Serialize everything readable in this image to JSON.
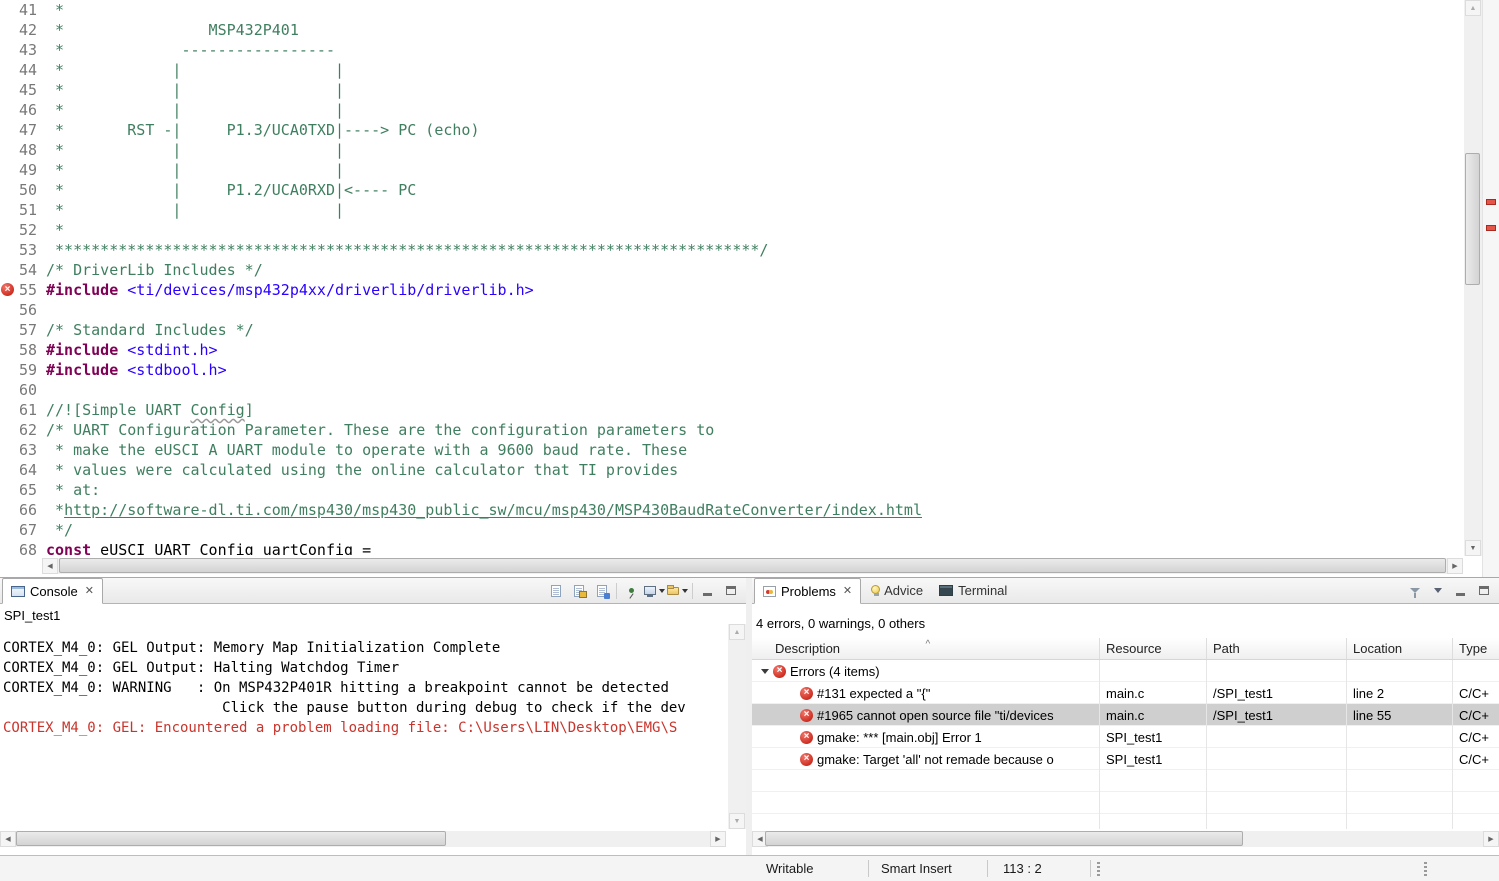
{
  "editor": {
    "lines": [
      {
        "n": "41",
        "segs": [
          {
            "t": " *",
            "c": "cm"
          }
        ]
      },
      {
        "n": "42",
        "segs": [
          {
            "t": " *                MSP432P401",
            "c": "cm"
          }
        ]
      },
      {
        "n": "43",
        "segs": [
          {
            "t": " *             -----------------",
            "c": "cm"
          }
        ]
      },
      {
        "n": "44",
        "segs": [
          {
            "t": " *            |                 |",
            "c": "cm"
          }
        ]
      },
      {
        "n": "45",
        "segs": [
          {
            "t": " *            |                 |",
            "c": "cm"
          }
        ]
      },
      {
        "n": "46",
        "segs": [
          {
            "t": " *            |                 |",
            "c": "cm"
          }
        ]
      },
      {
        "n": "47",
        "segs": [
          {
            "t": " *       RST -|     P1.3/UCA0TXD|----> PC (echo)",
            "c": "cm"
          }
        ]
      },
      {
        "n": "48",
        "segs": [
          {
            "t": " *            |                 |",
            "c": "cm"
          }
        ]
      },
      {
        "n": "49",
        "segs": [
          {
            "t": " *            |                 |",
            "c": "cm"
          }
        ]
      },
      {
        "n": "50",
        "segs": [
          {
            "t": " *            |     P1.2/UCA0RXD|<---- PC",
            "c": "cm"
          }
        ]
      },
      {
        "n": "51",
        "segs": [
          {
            "t": " *            |                 |",
            "c": "cm"
          }
        ]
      },
      {
        "n": "52",
        "segs": [
          {
            "t": " *",
            "c": "cm"
          }
        ]
      },
      {
        "n": "53",
        "segs": [
          {
            "t": " ******************************************************************************/",
            "c": "cm"
          }
        ]
      },
      {
        "n": "54",
        "segs": [
          {
            "t": "/* DriverLib Includes */",
            "c": "cm"
          }
        ]
      },
      {
        "n": "55",
        "marker": "error",
        "segs": [
          {
            "t": "#include",
            "c": "dir"
          },
          {
            "t": " ",
            "c": "pl"
          },
          {
            "t": "<ti/devices/msp432p4xx/driverlib/driverlib.h>",
            "c": "str"
          }
        ]
      },
      {
        "n": "56",
        "segs": []
      },
      {
        "n": "57",
        "segs": [
          {
            "t": "/* Standard Includes */",
            "c": "cm"
          }
        ]
      },
      {
        "n": "58",
        "segs": [
          {
            "t": "#include",
            "c": "dir"
          },
          {
            "t": " ",
            "c": "pl"
          },
          {
            "t": "<stdint.h>",
            "c": "str"
          }
        ]
      },
      {
        "n": "59",
        "segs": [
          {
            "t": "#include",
            "c": "dir"
          },
          {
            "t": " ",
            "c": "pl"
          },
          {
            "t": "<stdbool.h>",
            "c": "str"
          }
        ]
      },
      {
        "n": "60",
        "segs": []
      },
      {
        "n": "61",
        "segs": [
          {
            "t": "//![Simple UART ",
            "c": "cm"
          },
          {
            "t": "Config",
            "c": "cm sq"
          },
          {
            "t": "]",
            "c": "cm"
          }
        ]
      },
      {
        "n": "62",
        "segs": [
          {
            "t": "/* UART Configuration Parameter. These are the configuration parameters to",
            "c": "cm"
          }
        ]
      },
      {
        "n": "63",
        "segs": [
          {
            "t": " * make the eUSCI A UART module to operate with a 9600 baud rate. These",
            "c": "cm"
          }
        ]
      },
      {
        "n": "64",
        "segs": [
          {
            "t": " * values were calculated using the online calculator that TI provides",
            "c": "cm"
          }
        ]
      },
      {
        "n": "65",
        "segs": [
          {
            "t": " * at:",
            "c": "cm"
          }
        ]
      },
      {
        "n": "66",
        "segs": [
          {
            "t": " *",
            "c": "cm"
          },
          {
            "t": "http://software-dl.ti.com/msp430/msp430_public_sw/mcu/msp430/MSP430BaudRateConverter/index.html",
            "c": "cm ul"
          }
        ]
      },
      {
        "n": "67",
        "segs": [
          {
            "t": " */",
            "c": "cm"
          }
        ]
      },
      {
        "n": "68",
        "segs": [
          {
            "t": "const",
            "c": "dir"
          },
          {
            "t": " eUSCI_UART_Config uartConfig =",
            "c": "pl"
          }
        ]
      }
    ]
  },
  "console": {
    "tab_label": "Console",
    "title": "SPI_test1",
    "lines": [
      {
        "t": "CORTEX_M4_0: GEL Output: Memory Map Initialization Complete",
        "c": "out"
      },
      {
        "t": "CORTEX_M4_0: GEL Output: Halting Watchdog Timer",
        "c": "out"
      },
      {
        "t": "CORTEX_M4_0: WARNING   : On MSP432P401R hitting a breakpoint cannot be detected",
        "c": "out"
      },
      {
        "t": "                          Click the pause button during debug to check if the dev",
        "c": "out"
      },
      {
        "t": "CORTEX_M4_0: GEL: Encountered a problem loading file: C:\\Users\\LIN\\Desktop\\EMG\\S",
        "c": "err"
      }
    ],
    "toolbar": [
      {
        "name": "clear-console"
      },
      {
        "name": "scroll-lock"
      },
      {
        "name": "word-wrap"
      },
      {
        "sep": true
      },
      {
        "name": "pin-console"
      },
      {
        "name": "display-selected-console",
        "dd": true
      },
      {
        "name": "open-console",
        "dd": true
      },
      {
        "sep": true
      },
      {
        "name": "minimize"
      },
      {
        "name": "maximize"
      }
    ]
  },
  "problems": {
    "tab_label": "Problems",
    "advice_label": "Advice",
    "terminal_label": "Terminal",
    "summary": "4 errors, 0 warnings, 0 others",
    "columns": [
      "Description",
      "Resource",
      "Path",
      "Location",
      "Type"
    ],
    "group_label": "Errors (4 items)",
    "rows": [
      {
        "description": "#131 expected a \"{\"",
        "resource": "main.c",
        "path": "/SPI_test1",
        "location": "line 2",
        "type": "C/C+",
        "selected": false
      },
      {
        "description": "#1965 cannot open source file \"ti/devices",
        "resource": "main.c",
        "path": "/SPI_test1",
        "location": "line 55",
        "type": "C/C+",
        "selected": true
      },
      {
        "description": "gmake: *** [main.obj] Error 1",
        "resource": "SPI_test1",
        "path": "",
        "location": "",
        "type": "C/C+",
        "selected": false
      },
      {
        "description": "gmake: Target 'all' not remade because o",
        "resource": "SPI_test1",
        "path": "",
        "location": "",
        "type": "C/C+",
        "selected": false
      }
    ],
    "toolbar": [
      {
        "name": "filter"
      },
      {
        "name": "view-menu"
      },
      {
        "name": "minimize"
      },
      {
        "name": "maximize"
      }
    ]
  },
  "status_bar": {
    "writable": "Writable",
    "smart_insert": "Smart Insert",
    "cursor_position": "113 : 2"
  }
}
